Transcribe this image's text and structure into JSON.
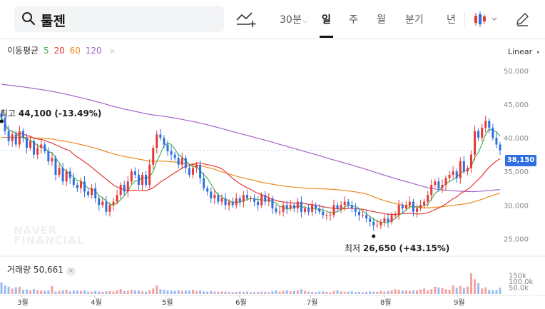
{
  "search": {
    "value": "툴젠"
  },
  "toolbar": {
    "period_30m": "30분",
    "periods": [
      "일",
      "주",
      "월",
      "분기",
      "년"
    ],
    "active_period": "일"
  },
  "legend": {
    "label": "이동평균",
    "ma": [
      {
        "period": "5",
        "color": "#4caf50"
      },
      {
        "period": "20",
        "color": "#e53935"
      },
      {
        "period": "60",
        "color": "#f08a24"
      },
      {
        "period": "120",
        "color": "#a464c8"
      }
    ],
    "close": "×"
  },
  "scale": {
    "label": "Linear"
  },
  "annotations": {
    "high_prefix": "최고 ",
    "high_value": "44,100 (-13.49%)",
    "low_prefix": "최저 ",
    "low_value": "26,650 (+43.15%)"
  },
  "last_price": "38,150",
  "watermark": [
    "NAVER",
    "FINANCIAL"
  ],
  "volume": {
    "label": "거래량 50,661",
    "close": "×"
  },
  "colors": {
    "up": "#e53935",
    "down": "#2f6fe0",
    "up_volume": "#f4a3a3",
    "down_volume": "#9bbcf0"
  },
  "chart_data": {
    "type": "candlestick",
    "y_ticks": [
      "50,000",
      "45,000",
      "40,000",
      "35,000",
      "30,000",
      "25,000"
    ],
    "y_tick_values": [
      50000,
      45000,
      40000,
      35000,
      30000,
      25000
    ],
    "ylim": [
      22500,
      52000
    ],
    "x_tick_labels": [
      "3월",
      "4월",
      "5월",
      "6월",
      "7월",
      "8월",
      "9월"
    ],
    "x_tick_dates": [
      "2023-03-01",
      "2023-04-01",
      "2023-05-01",
      "2023-06-01",
      "2023-07-01",
      "2023-08-01",
      "2023-09-01"
    ],
    "volume_ticks": [
      "150k",
      "100.0k",
      "50.0k"
    ],
    "volume_tick_values": [
      150000,
      100000,
      50000
    ],
    "close": [
      43000,
      41000,
      39500,
      40500,
      39000,
      41000,
      40000,
      38500,
      39500,
      37500,
      38500,
      39000,
      38000,
      36500,
      37000,
      34500,
      35500,
      33500,
      35000,
      34000,
      33000,
      32500,
      33500,
      32000,
      31500,
      32500,
      31000,
      30000,
      30500,
      29000,
      30000,
      30500,
      31500,
      33000,
      32000,
      33500,
      35000,
      34500,
      33000,
      34500,
      33000,
      36000,
      38500,
      40500,
      40000,
      39000,
      38000,
      37500,
      37000,
      36000,
      37000,
      35500,
      34500,
      35500,
      36000,
      34000,
      32500,
      32000,
      31000,
      31500,
      30500,
      31000,
      30000,
      30500,
      30000,
      31000,
      30500,
      31500,
      31000,
      31000,
      30500,
      30000,
      31500,
      30500,
      31000,
      29500,
      29000,
      29000,
      30000,
      29500,
      30000,
      29500,
      30500,
      29000,
      29500,
      29000,
      30000,
      29500,
      29000,
      28500,
      28500,
      28500,
      30000,
      29500,
      30000,
      30500,
      30000,
      29500,
      29000,
      28500,
      28500,
      28000,
      27500,
      27000,
      27000,
      27500,
      28000,
      27500,
      28500,
      28500,
      30000,
      29500,
      30000,
      30500,
      29000,
      29500,
      30000,
      30500,
      31500,
      33000,
      33500,
      32500,
      33000,
      34000,
      34500,
      35000,
      34000,
      36500,
      35000,
      35500,
      37500,
      41000,
      40000,
      41500,
      42500,
      41500,
      40000,
      39000,
      38150
    ],
    "volume": [
      95000,
      70000,
      60000,
      45000,
      55000,
      60000,
      35000,
      38000,
      30000,
      40000,
      32000,
      28000,
      25000,
      30000,
      65000,
      20000,
      25000,
      30000,
      35000,
      22000,
      28000,
      30000,
      25000,
      30000,
      20000,
      20000,
      25000,
      20000,
      18000,
      22000,
      25000,
      20000,
      30000,
      40000,
      25000,
      25000,
      35000,
      30000,
      28000,
      22000,
      20000,
      30000,
      45000,
      70000,
      40000,
      35000,
      30000,
      28000,
      25000,
      30000,
      25000,
      30000,
      28000,
      35000,
      25000,
      30000,
      22000,
      20000,
      25000,
      20000,
      18000,
      22000,
      20000,
      18000,
      15000,
      18000,
      20000,
      18000,
      20000,
      15000,
      16000,
      18000,
      20000,
      18000,
      15000,
      22000,
      30000,
      20000,
      25000,
      30000,
      22000,
      25000,
      30000,
      40000,
      25000,
      20000,
      18000,
      15000,
      20000,
      22000,
      18000,
      15000,
      25000,
      30000,
      22000,
      18000,
      20000,
      22000,
      15000,
      18000,
      15000,
      18000,
      20000,
      20000,
      18000,
      25000,
      20000,
      25000,
      30000,
      40000,
      35000,
      28000,
      30000,
      25000,
      30000,
      30000,
      38000,
      45000,
      30000,
      40000,
      60000,
      55000,
      50000,
      40000,
      35000,
      70000,
      50000,
      65000,
      50000,
      60000,
      170000,
      120000,
      90000,
      45000,
      55000,
      35000,
      30000,
      32000,
      50661
    ]
  }
}
